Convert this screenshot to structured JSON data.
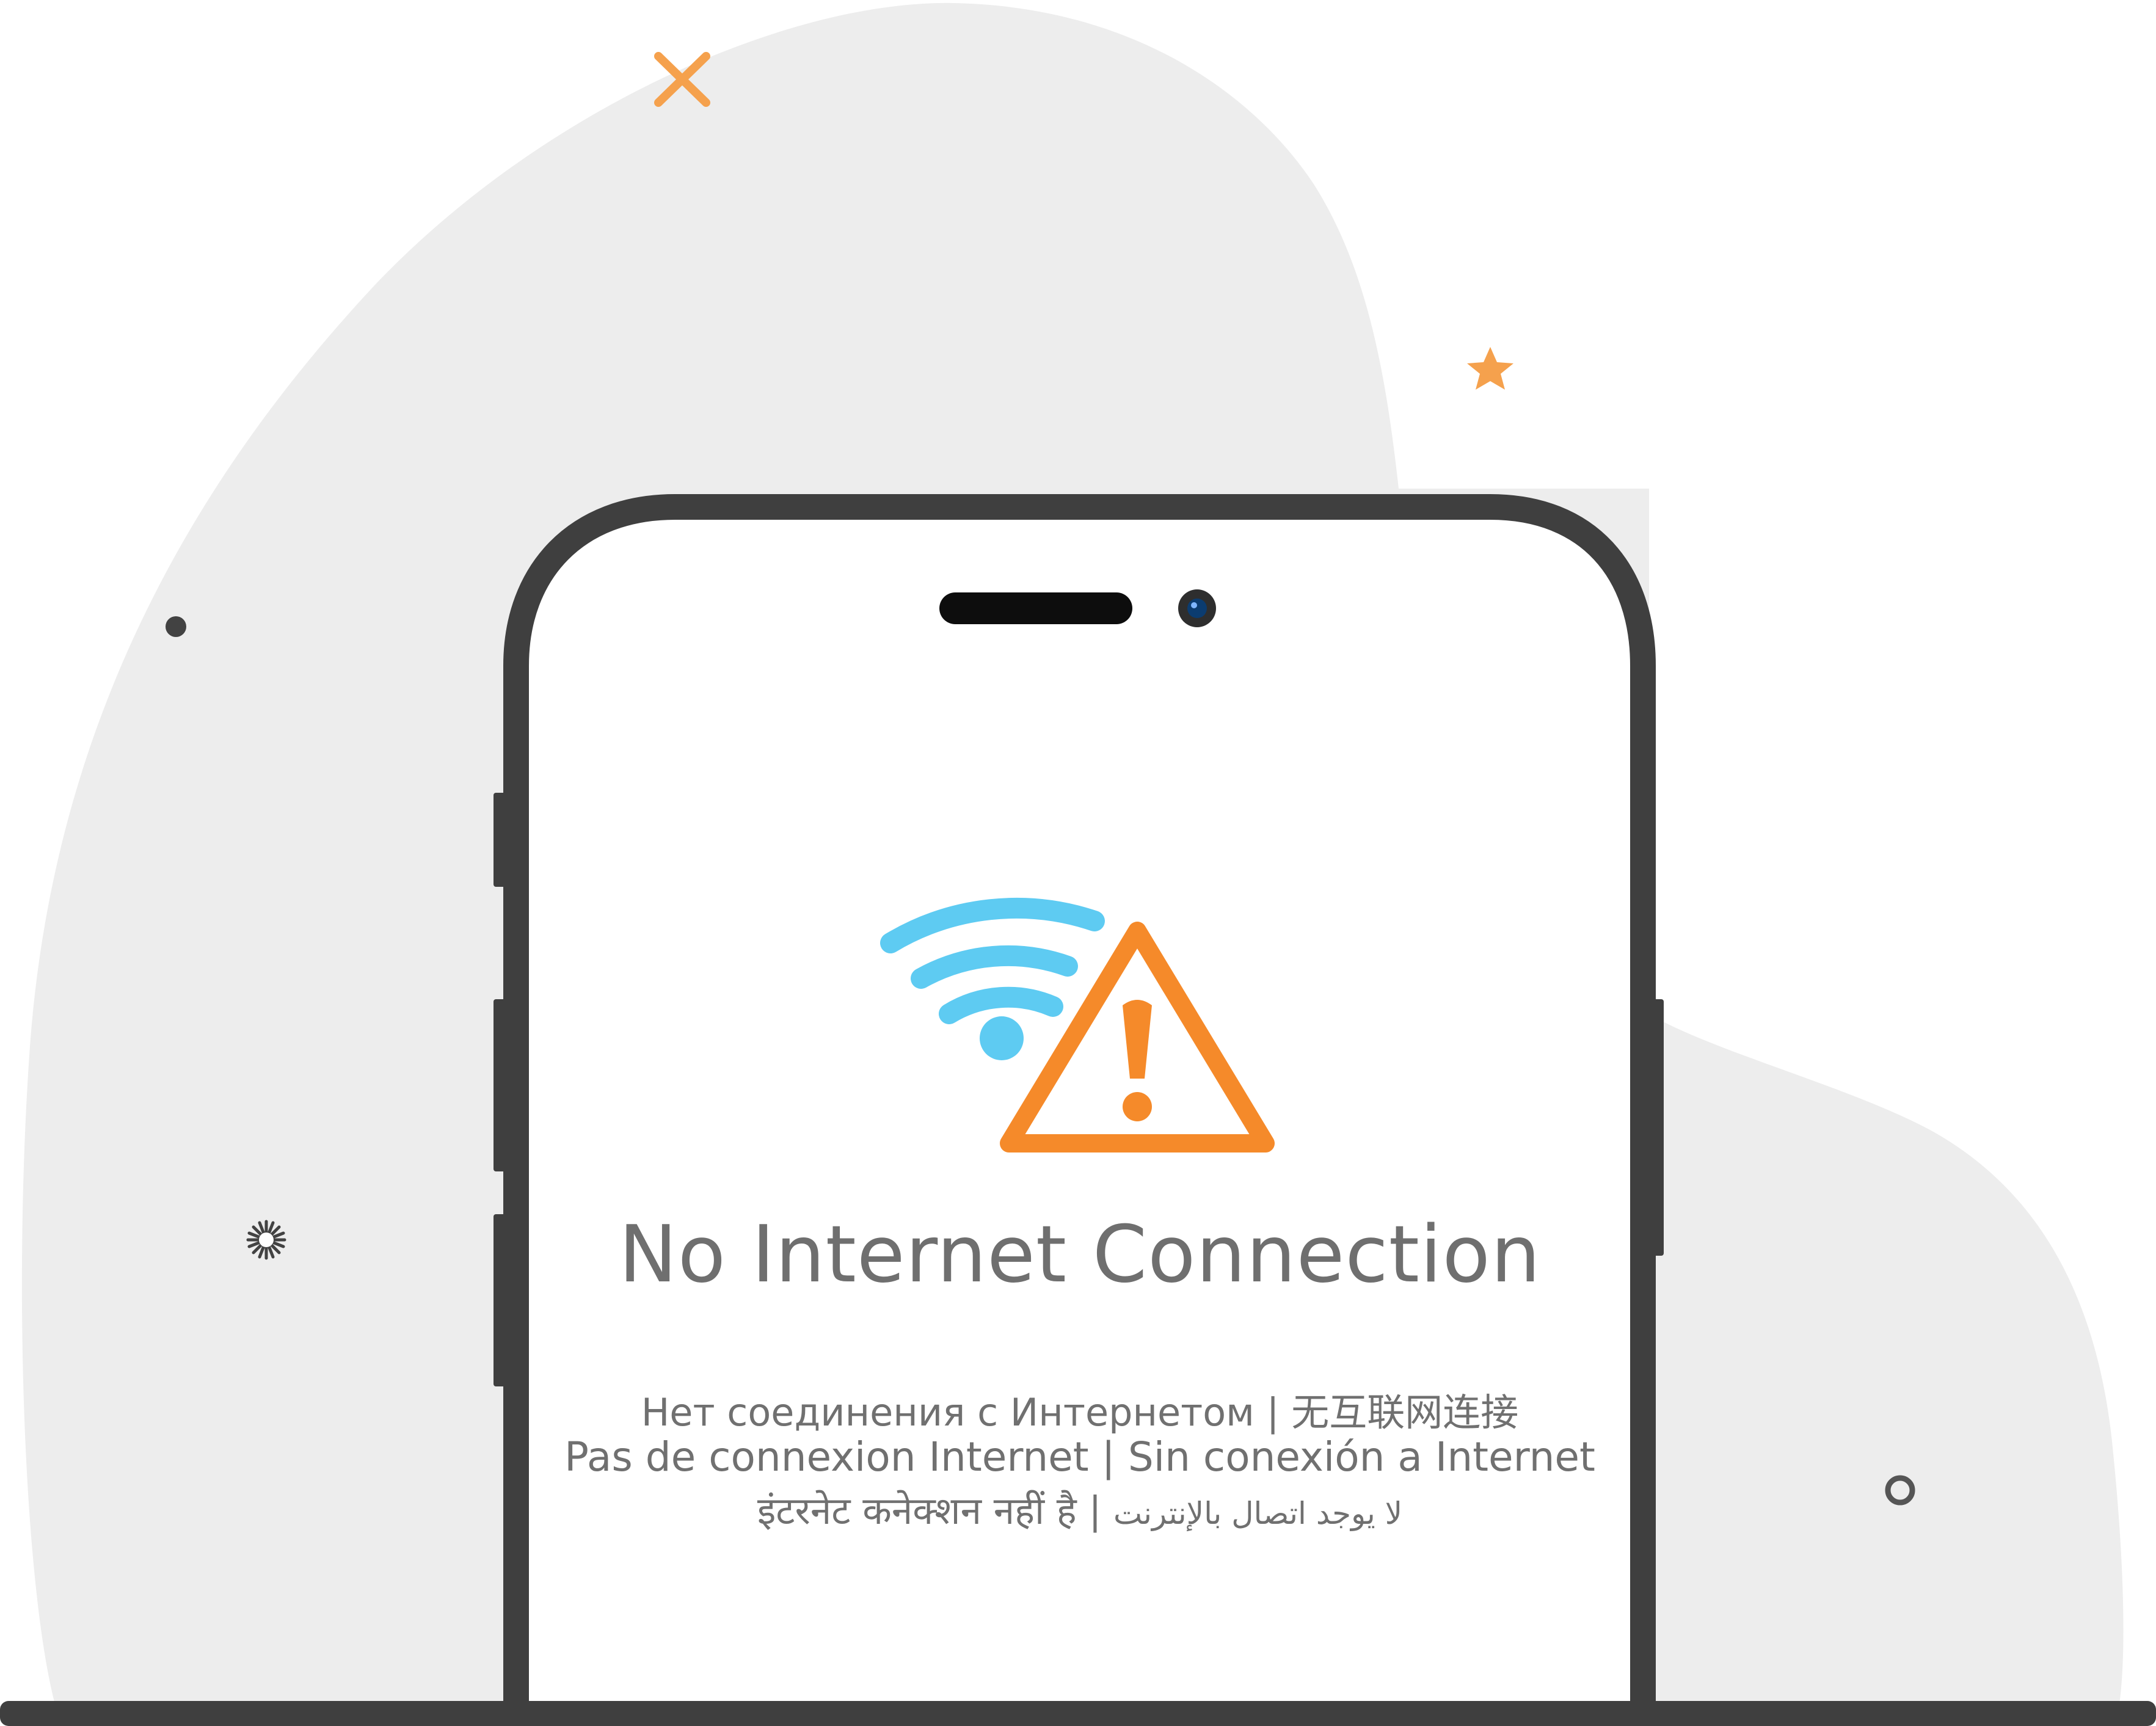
{
  "screen": {
    "title": "No Internet Connection",
    "translations": {
      "russian": "Нет соединения с Интернетом",
      "chinese": "无互联网连接",
      "french": "Pas de connexion Internet",
      "spanish": "Sin conexión a Internet",
      "hindi": "इंटरनेट कनेक्शन नहीं है",
      "arabic": "لا يوجد اتصال بالإنترنت",
      "separator": "|"
    }
  },
  "icons": {
    "main": "wifi-icon",
    "status": "warning-triangle-icon"
  },
  "colors": {
    "wifi": "#5ecbf2",
    "warning": "#f58a2a",
    "phone_frame": "#3f3f3f",
    "blob": "#ededed",
    "text": "#6f6f6f",
    "decoration_orange": "#f5a14d"
  }
}
